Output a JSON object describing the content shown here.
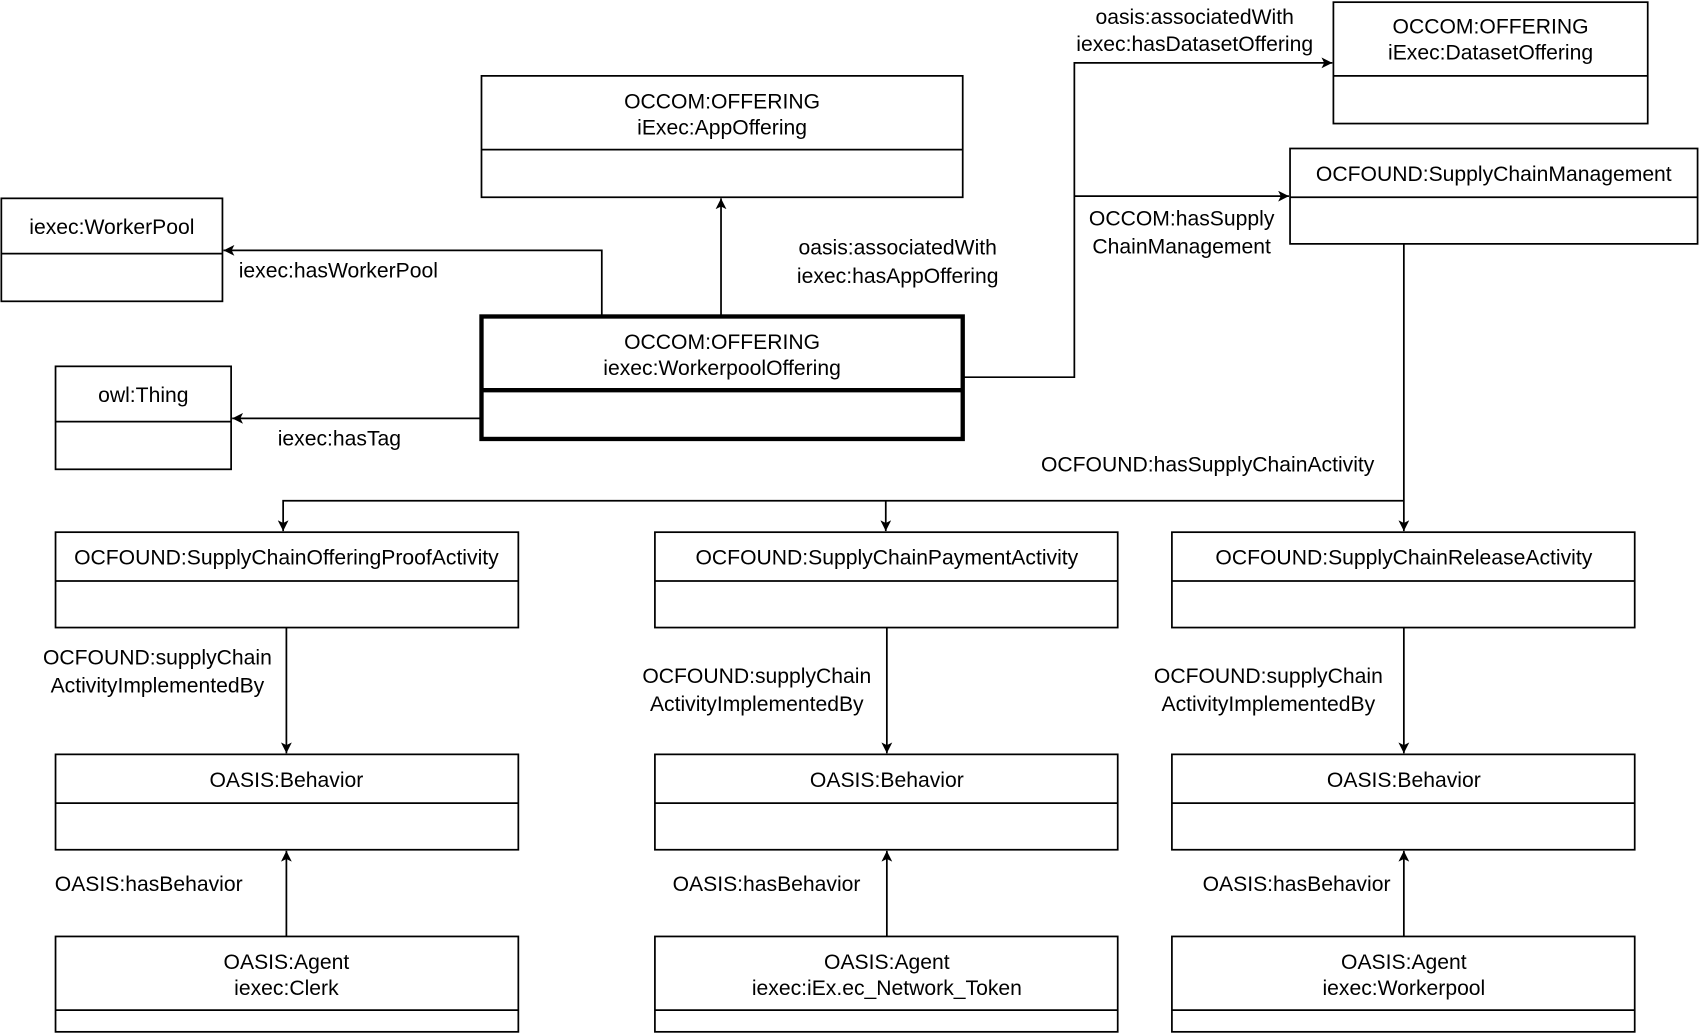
{
  "classes": {
    "app_offering": {
      "line1": "OCCOM:OFFERING",
      "line2": "iExec:AppOffering"
    },
    "worker_pool": {
      "line1": "iexec:WorkerPool"
    },
    "owl_thing": {
      "line1": "owl:Thing"
    },
    "workerpool_offering": {
      "line1": "OCCOM:OFFERING",
      "line2": "iexec:WorkerpoolOffering"
    },
    "dataset_offering": {
      "line1": "OCCOM:OFFERING",
      "line2": "iExec:DatasetOffering"
    },
    "supply_chain_management": {
      "line1": "OCFOUND:SupplyChainManagement"
    },
    "activities": [
      {
        "line1": "OCFOUND:SupplyChainOfferingProofActivity"
      },
      {
        "line1": "OCFOUND:SupplyChainPaymentActivity"
      },
      {
        "line1": "OCFOUND:SupplyChainReleaseActivity"
      }
    ],
    "behaviors": [
      {
        "line1": "OASIS:Behavior"
      },
      {
        "line1": "OASIS:Behavior"
      },
      {
        "line1": "OASIS:Behavior"
      }
    ],
    "agents": [
      {
        "line1": "OASIS:Agent",
        "line2": "iexec:Clerk"
      },
      {
        "line1": "OASIS:Agent",
        "line2": "iexec:iEx.ec_Network_Token"
      },
      {
        "line1": "OASIS:Agent",
        "line2": "iexec:Workerpool"
      }
    ]
  },
  "edges": {
    "has_worker_pool": "iexec:hasWorkerPool",
    "has_tag": "iexec:hasTag",
    "app_offering": {
      "line1": "oasis:associatedWith",
      "line2": "iexec:hasAppOffering"
    },
    "dataset_offering": {
      "line1": "oasis:associatedWith",
      "line2": "iexec:hasDatasetOffering"
    },
    "supply_chain_mgmt": {
      "line1": "OCCOM:hasSupply",
      "line2": "ChainManagement"
    },
    "has_activity": "OCFOUND:hasSupplyChainActivity",
    "implemented_by": [
      {
        "line1": "OCFOUND:supplyChain",
        "line2": "ActivityImplementedBy"
      },
      {
        "line1": "OCFOUND:supplyChain",
        "line2": "ActivityImplementedBy"
      },
      {
        "line1": "OCFOUND:supplyChain",
        "line2": "ActivityImplementedBy"
      }
    ],
    "has_behavior": [
      "OASIS:hasBehavior",
      "OASIS:hasBehavior",
      "OASIS:hasBehavior"
    ]
  }
}
